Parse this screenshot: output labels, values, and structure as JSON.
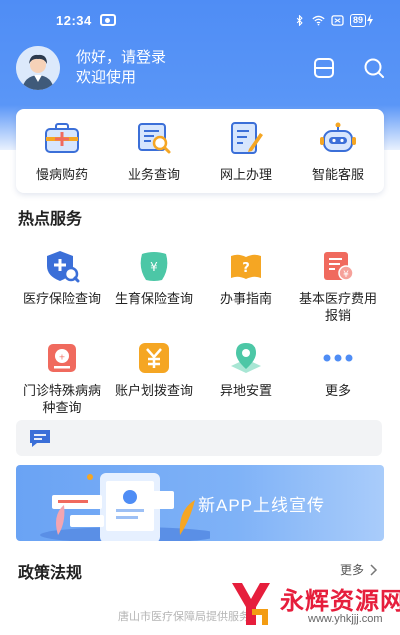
{
  "status_bar": {
    "time": "12:34",
    "battery": "89"
  },
  "header": {
    "greeting": "你好，请登录",
    "subtitle": "欢迎使用"
  },
  "quick_actions": [
    {
      "label": "慢病购药",
      "icon": "medicine-kit-icon"
    },
    {
      "label": "业务查询",
      "icon": "business-search-icon"
    },
    {
      "label": "网上办理",
      "icon": "online-form-icon"
    },
    {
      "label": "智能客服",
      "icon": "robot-service-icon"
    }
  ],
  "hot_services": {
    "title": "热点服务",
    "items": [
      {
        "label": "医疗保险查询",
        "icon": "medical-insurance-icon"
      },
      {
        "label": "生育保险查询",
        "icon": "maternity-insurance-icon"
      },
      {
        "label": "办事指南",
        "icon": "guide-icon"
      },
      {
        "label": "基本医疗费用报销",
        "icon": "reimbursement-icon"
      },
      {
        "label": "门诊特殊病病种查询",
        "icon": "special-disease-icon"
      },
      {
        "label": "账户划拨查询",
        "icon": "account-transfer-icon"
      },
      {
        "label": "异地安置",
        "icon": "relocation-icon"
      },
      {
        "label": "更多",
        "icon": "more-dots-icon"
      }
    ]
  },
  "banner": {
    "text": "新APP上线宣传"
  },
  "policy": {
    "title": "政策法规",
    "more": "更多"
  },
  "footer": {
    "text": "唐山市医疗保障局提供服务"
  },
  "watermark": {
    "title": "永辉资源网",
    "url": "www.yhkjjj.com"
  },
  "colors": {
    "primary": "#4f8df5",
    "accent_orange": "#f5a623",
    "accent_red": "#f06a5e",
    "accent_green": "#4cc7a6"
  }
}
